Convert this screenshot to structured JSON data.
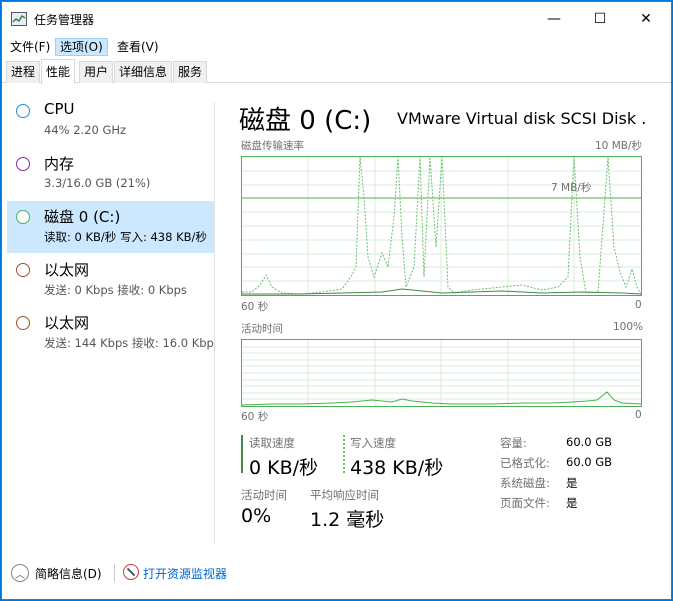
{
  "window": {
    "title": "任务管理器",
    "minimize": "—",
    "maximize": "☐",
    "close": "✕"
  },
  "menu": [
    "文件(F)",
    "选项(O)",
    "查看(V)"
  ],
  "tabs": [
    "进程",
    "性能",
    "用户",
    "详细信息",
    "服务"
  ],
  "active_tab": "性能",
  "sidebar": {
    "items": [
      {
        "title": "CPU",
        "sub": "44%  2.20 GHz",
        "color": "#1f8fd6"
      },
      {
        "title": "内存",
        "sub": "3.3/16.0 GB (21%)",
        "color": "#8b2aa8"
      },
      {
        "title": "磁盘 0 (C:)",
        "sub": "读取: 0 KB/秒 写入: 438 KB/秒",
        "color": "#4caf4f"
      },
      {
        "title": "以太网",
        "sub": "发送: 0 Kbps 接收: 0 Kbps",
        "color": "#a0522d"
      },
      {
        "title": "以太网",
        "sub": "发送: 144 Kbps 接收: 16.0 Kbps",
        "color": "#a0522d"
      }
    ],
    "selected_index": 2
  },
  "main": {
    "title": "磁盘 0 (C:)",
    "model": "VMware Virtual disk SCSI Disk ...",
    "chart1": {
      "label": "磁盘传输速率",
      "max": "10 MB/秒",
      "mid": "7 MB/秒",
      "left_axis": "60 秒",
      "right_axis": "0"
    },
    "chart2": {
      "label": "活动时间",
      "max": "100%",
      "left_axis": "60 秒",
      "right_axis": "0"
    },
    "stats": {
      "read_label": "读取速度",
      "read_value": "0 KB/秒",
      "write_label": "写入速度",
      "write_value": "438 KB/秒",
      "active_label": "活动时间",
      "active_value": "0%",
      "resp_label": "平均响应时间",
      "resp_value": "1.2 毫秒"
    },
    "props": [
      {
        "label": "容量:",
        "value": "60.0 GB"
      },
      {
        "label": "已格式化:",
        "value": "60.0 GB"
      },
      {
        "label": "系统磁盘:",
        "value": "是"
      },
      {
        "label": "页面文件:",
        "value": "是"
      }
    ]
  },
  "footer": {
    "summary": "简略信息(D)",
    "monitor_link": "打开资源监视器"
  },
  "colors": {
    "accent": "#4caf4f",
    "selection": "#cce8ff",
    "link": "#0066cc"
  }
}
